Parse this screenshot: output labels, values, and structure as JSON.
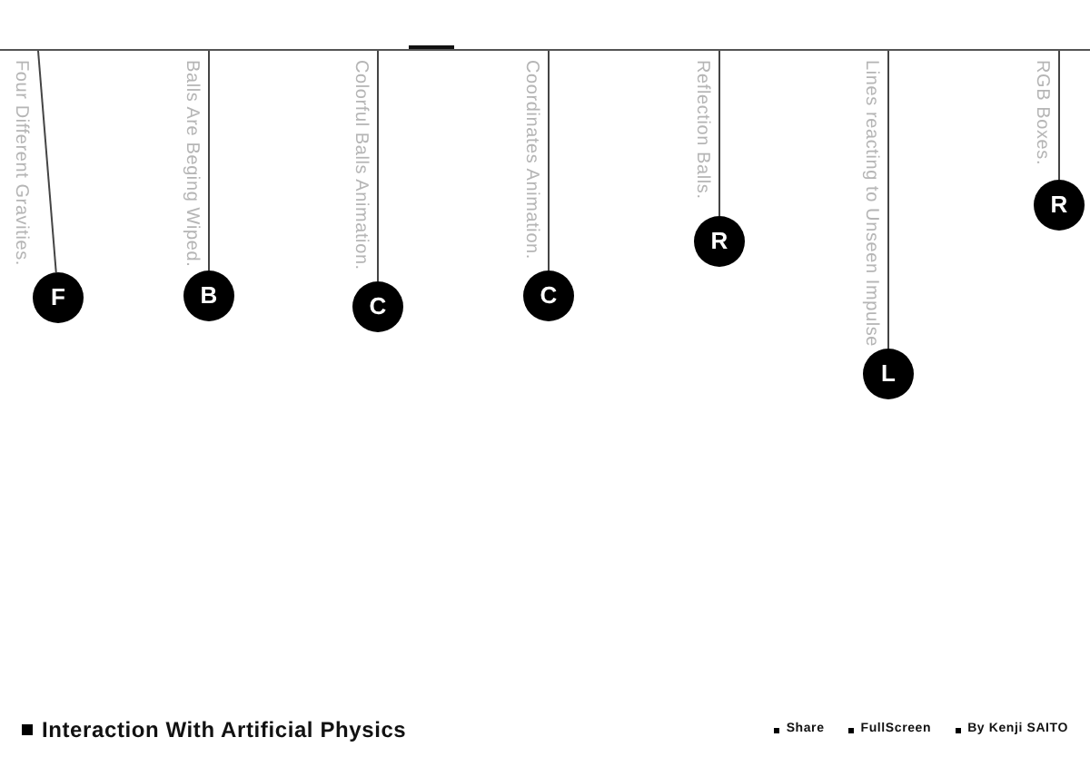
{
  "pendants": [
    {
      "label": "Four Different Gravities.",
      "letter": "F"
    },
    {
      "label": "Balls Are Beging Wiped.",
      "letter": "B"
    },
    {
      "label": "Colorful Balls Animation.",
      "letter": "C"
    },
    {
      "label": "Coordinates Animation.",
      "letter": "C"
    },
    {
      "label": "Reflection Balls.",
      "letter": "R"
    },
    {
      "label": "Lines reacting to Unseen Impulse",
      "letter": "L"
    },
    {
      "label": "RGB Boxes.",
      "letter": "R"
    }
  ],
  "footer": {
    "title": "Interaction With Artificial Physics",
    "links": [
      "Share",
      "FullScreen",
      "By Kenji SAITO"
    ]
  }
}
